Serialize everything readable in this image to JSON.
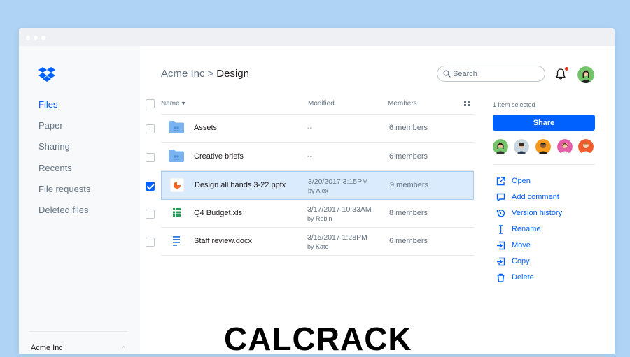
{
  "sidebar": {
    "items": [
      {
        "label": "Files",
        "active": true
      },
      {
        "label": "Paper"
      },
      {
        "label": "Sharing"
      },
      {
        "label": "Recents"
      },
      {
        "label": "File requests"
      },
      {
        "label": "Deleted files"
      }
    ],
    "team": "Acme Inc"
  },
  "header": {
    "breadcrumb_parent": "Acme Inc",
    "breadcrumb_separator": ">",
    "breadcrumb_current": "Design",
    "search_placeholder": "Search"
  },
  "table": {
    "columns": {
      "name": "Name",
      "modified": "Modified",
      "members": "Members"
    },
    "sort_indicator": "▾",
    "rows": [
      {
        "name": "Assets",
        "type": "folder",
        "modified": "--",
        "by": "",
        "members": "6 members",
        "selected": false
      },
      {
        "name": "Creative briefs",
        "type": "folder",
        "modified": "--",
        "by": "",
        "members": "6 members",
        "selected": false
      },
      {
        "name": "Design all hands 3-22.pptx",
        "type": "pptx",
        "modified": "3/20/2017 3:15PM",
        "by": "by Alex",
        "members": "9 members",
        "selected": true
      },
      {
        "name": "Q4 Budget.xls",
        "type": "xls",
        "modified": "3/17/2017 10:33AM",
        "by": "by Robin",
        "members": "8 members",
        "selected": false
      },
      {
        "name": "Staff review.docx",
        "type": "docx",
        "modified": "3/15/2017 1:28PM",
        "by": "by Kate",
        "members": "6 members",
        "selected": false
      }
    ]
  },
  "panel": {
    "selected_count": "1 item selected",
    "share_label": "Share",
    "actions": [
      {
        "label": "Open",
        "icon": "open-external-icon"
      },
      {
        "label": "Add comment",
        "icon": "comment-icon"
      },
      {
        "label": "Version history",
        "icon": "history-icon"
      },
      {
        "label": "Rename",
        "icon": "rename-cursor-icon"
      },
      {
        "label": "Move",
        "icon": "move-icon"
      },
      {
        "label": "Copy",
        "icon": "copy-icon"
      },
      {
        "label": "Delete",
        "icon": "trash-icon"
      }
    ]
  },
  "watermark": "CALCRACK",
  "colors": {
    "accent": "#0061fe",
    "background": "#aed3f4",
    "selected_row": "#d9ebfc",
    "folder": "#7ab3ef",
    "notification": "#e03b24"
  }
}
